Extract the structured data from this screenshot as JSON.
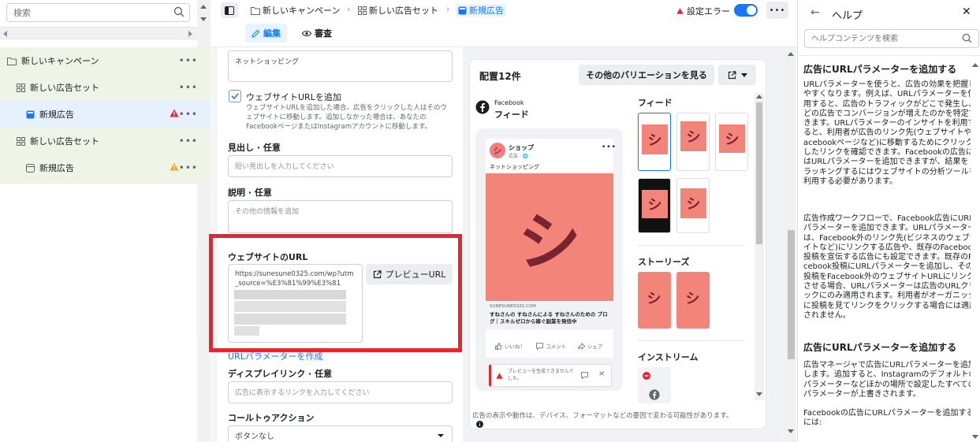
{
  "left_sidebar": {
    "search_placeholder": "検索",
    "tree": [
      {
        "label": "新しいキャンペーン",
        "type": "campaign"
      },
      {
        "label": "新しい広告セット",
        "type": "adset"
      },
      {
        "label": "新規広告",
        "type": "ad",
        "status": "error"
      },
      {
        "label": "新しい広告セット",
        "type": "adset"
      },
      {
        "label": "新規広告",
        "type": "ad",
        "status": "warning"
      }
    ]
  },
  "topbar": {
    "breadcrumbs": [
      "新しいキャンペーン",
      "新しい広告セット",
      "新規広告"
    ],
    "error_label": "設定エラー",
    "tabs": {
      "edit": "編集",
      "review": "審査"
    }
  },
  "form": {
    "top_textarea_value": "ネットショッピング",
    "website_url_checkbox_label": "ウェブサイトURLを追加",
    "website_url_checkbox_desc": "ウェブサイトURLを追加した場合、広告をクリックした人はそのウェブサイトに移動します。追加しなかった場合は、あなたのFacebookページまたはInstagramアカウントに移動します。",
    "headline_label": "見出し · 任意",
    "headline_placeholder": "短い見出しを入力してください",
    "description_label": "説明 · 任意",
    "description_placeholder": "その他の情報を追加",
    "website_url_label": "ウェブサイトのURL",
    "website_url_value": "https://sunesune0325.com/wp?utm_source=%E3%81%99%E3%81",
    "preview_url_button": "プレビューURL",
    "url_param_link": "URLパラメーターを作成",
    "display_link_label": "ディスプレイリンク · 任意",
    "display_link_placeholder": "広告に表示するリンクを入力してください",
    "cta_label": "コールトゥアクション",
    "cta_value": "ボタンなし"
  },
  "preview": {
    "placements_count": "配置12件",
    "variations_button": "その他のバリエーションを見る",
    "platform_small": "Facebook",
    "platform_large": "フィード",
    "post": {
      "page_name": "ショップ",
      "page_sub": "広告 · 🌐",
      "text": "ネットショッピング",
      "image_glyph": "シ",
      "domain": "SUNESUNE0325.COM",
      "headline": "すねさんの すねさんによる すねさんのための ブログ｜スキルゼロから稼ぐ副業を発信中",
      "like": "いいね！",
      "comment": "コメント",
      "share": "シェア"
    },
    "error_message": "プレビューを生成できませんでした。",
    "sections": {
      "feed": "フィード",
      "stories": "ストーリーズ",
      "instream": "インストリーム"
    },
    "thumb_glyph": "シ",
    "disclaimer": "広告の表示や動作は、デバイス、フォーマットなどの要因で変わる可能性があります。"
  },
  "help": {
    "title": "ヘルプ",
    "search_placeholder": "ヘルプコンテンツを検索",
    "heading1": "広告にURLパラメーターを追加する",
    "para1": "URLパラメーターを使うと、広告の効果を把握しやすくなります。例えば、URLパラメーターを使用すると、広告のトラフィックがどこで発生し、どの広告でコンバージョンが増えたのかを特定できます。URLパラメーターのインサイトを利用すると、利用者が広告のリンク先(ウェブサイトやFacebookページなど)に移動するためにクリックしたリンクを確認できます。Facebookの広告にはURLパラメーターを追加できますが、結果をトラッキングするにはウェブサイトの分析ツールを利用する必要があります。",
    "para2": "広告作成ワークフローで、Facebook広告にURLパラメーターを追加できます。URLパラメーターは、Facebook外のリンク先(ビジネスのウェブサイトなど)にリンクする広告や、既存のFacebook投稿を宣伝する広告にも設定できます。既存のFacebook投稿にURLパラメーターを追加し、その投稿をFacebook外のウェブサイトURLにリンクさせる場合、URLパラメーターは広告のURLクリックにのみ適用されます。利用者がオーガニックに投稿を見てリンクをクリックする場合には適用されません。",
    "heading2": "広告にURLパラメーターを追加する",
    "para3": "広告マネージャで広告にURLパラメーターを追加します。追加すると、Instagramのデフォルトのパラメーターなどほかの場所で設定したすべてのパラメーターが上書きされます。",
    "para4": "Facebookの広告にURLパラメーターを追加するには:"
  },
  "colors": {
    "accent": "#1877f2",
    "error": "#e8242d",
    "warning": "#f5a623",
    "tree_bg": "#eef5e6",
    "ad_image": "#f2847a"
  }
}
